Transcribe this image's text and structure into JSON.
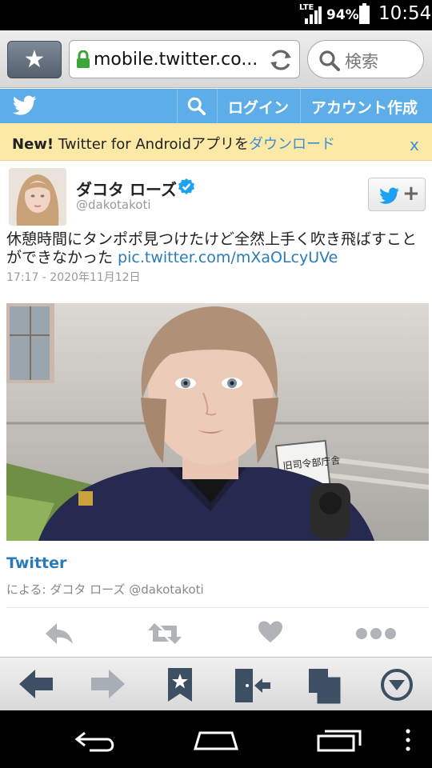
{
  "status_bar": {
    "network": "LTE",
    "battery_percent": "94%",
    "battery_level": 0.94,
    "time": "10:54"
  },
  "browser": {
    "url": "mobile.twitter.co...",
    "search_placeholder": "検索",
    "icons": [
      "star-icon",
      "lock-icon",
      "reload-icon",
      "search-icon"
    ]
  },
  "twitter_header": {
    "login_label": "ログイン",
    "signup_label": "アカウント作成"
  },
  "banner": {
    "new_label": "New!",
    "text": " Twitter for Androidアプリを",
    "download_link": "ダウンロード",
    "close_label": "x"
  },
  "tweet": {
    "display_name": "ダコタ ローズ",
    "handle": "@dakotakoti",
    "text": "休憩時間にタンポポ見つけたけど全然上手く吹き飛ばすことができなかった ",
    "link": "pic.twitter.com/mXaOLcyUVe",
    "timestamp": "17:17 - 2020年11月12日",
    "follow_plus": "+"
  },
  "card": {
    "title": "Twitter",
    "by_prefix": "による:",
    "by_name": "ダコタ ローズ",
    "by_handle": "@dakotakoti"
  },
  "colors": {
    "twitter_blue": "#5dade8",
    "link_blue": "#2b7bb9",
    "banner_bg": "#fde9a6",
    "icon_grey": "#b0b4b9"
  }
}
